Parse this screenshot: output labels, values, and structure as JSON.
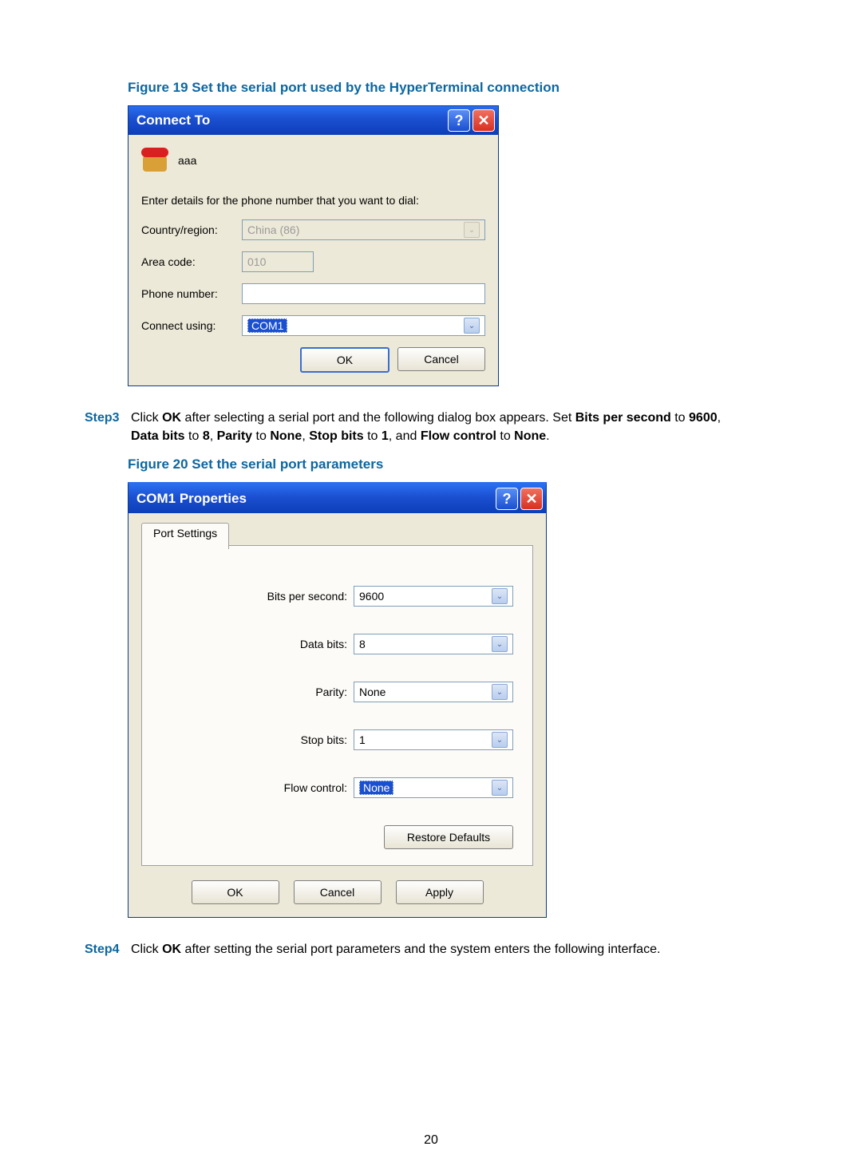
{
  "pageNumber": "20",
  "fig19": {
    "caption": "Figure 19 Set the serial port used by the HyperTerminal connection",
    "title": "Connect To",
    "connectionName": "aaa",
    "instruction": "Enter details for the phone number that you want to dial:",
    "countryLabel": "Country/region:",
    "countryValue": "China (86)",
    "areaLabel": "Area code:",
    "areaValue": "010",
    "phoneLabel": "Phone number:",
    "phoneValue": "",
    "connectLabel": "Connect using:",
    "connectValue": "COM1",
    "ok": "OK",
    "cancel": "Cancel"
  },
  "step3": {
    "label": "Step3",
    "p1a": "Click ",
    "p1b": "OK",
    "p1c": " after selecting a serial port and the following dialog box appears. Set ",
    "p1d": "Bits per second",
    "p1e": " to ",
    "p1f": "9600",
    "p1g": ", ",
    "p2a": "Data bits",
    "p2b": " to ",
    "p2c": "8",
    "p2d": ", ",
    "p2e": "Parity",
    "p2f": " to ",
    "p2g": "None",
    "p2h": ", ",
    "p2i": "Stop bits",
    "p2j": " to ",
    "p2k": "1",
    "p2l": ", and ",
    "p2m": "Flow control",
    "p2n": " to ",
    "p2o": "None",
    "p2p": "."
  },
  "fig20": {
    "caption": "Figure 20 Set the serial port parameters",
    "title": "COM1 Properties",
    "tab": "Port Settings",
    "bpsLabel": "Bits per second:",
    "bpsValue": "9600",
    "dataLabel": "Data bits:",
    "dataValue": "8",
    "parityLabel": "Parity:",
    "parityValue": "None",
    "stopLabel": "Stop bits:",
    "stopValue": "1",
    "flowLabel": "Flow control:",
    "flowValue": "None",
    "restore": "Restore Defaults",
    "ok": "OK",
    "cancel": "Cancel",
    "apply": "Apply"
  },
  "step4": {
    "label": "Step4",
    "a": "Click ",
    "b": "OK",
    "c": " after setting the serial port parameters and the system enters the following interface."
  }
}
